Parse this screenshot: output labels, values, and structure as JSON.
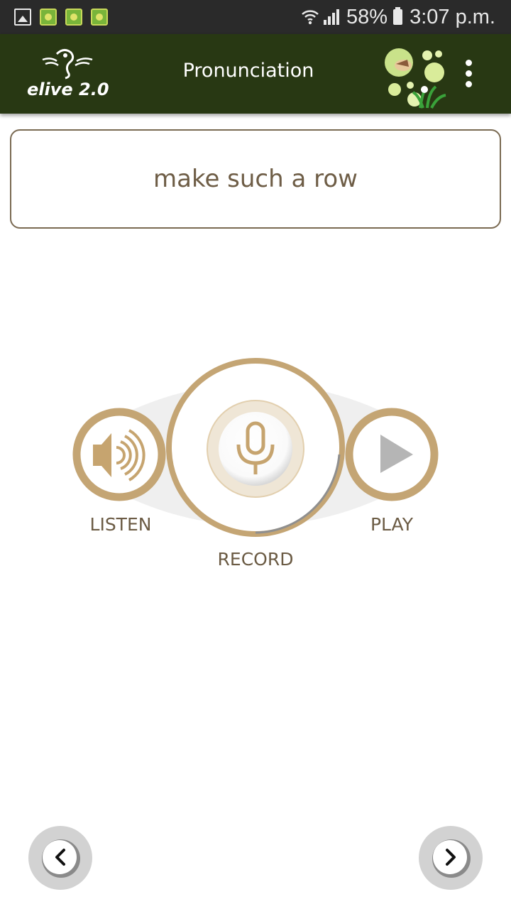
{
  "status_bar": {
    "icons": [
      "image-icon",
      "app-notification-icon",
      "app-notification-icon",
      "app-notification-icon",
      "wifi-icon",
      "signal-icon",
      "battery-icon"
    ],
    "battery": "58%",
    "time": "3:07 p.m."
  },
  "app_bar": {
    "logo_text": "elive 2.0",
    "title": "Pronunciation",
    "menu_icon": "more-vertical-icon",
    "background": "#283813"
  },
  "phrase": {
    "text": "make such a row"
  },
  "controls": {
    "listen_label": "LISTEN",
    "record_label": "RECORD",
    "play_label": "PLAY",
    "accent_color": "#c4a574",
    "icon_color": "#c6a46f"
  },
  "navigation": {
    "prev_icon": "chevron-left-icon",
    "next_icon": "chevron-right-icon"
  }
}
